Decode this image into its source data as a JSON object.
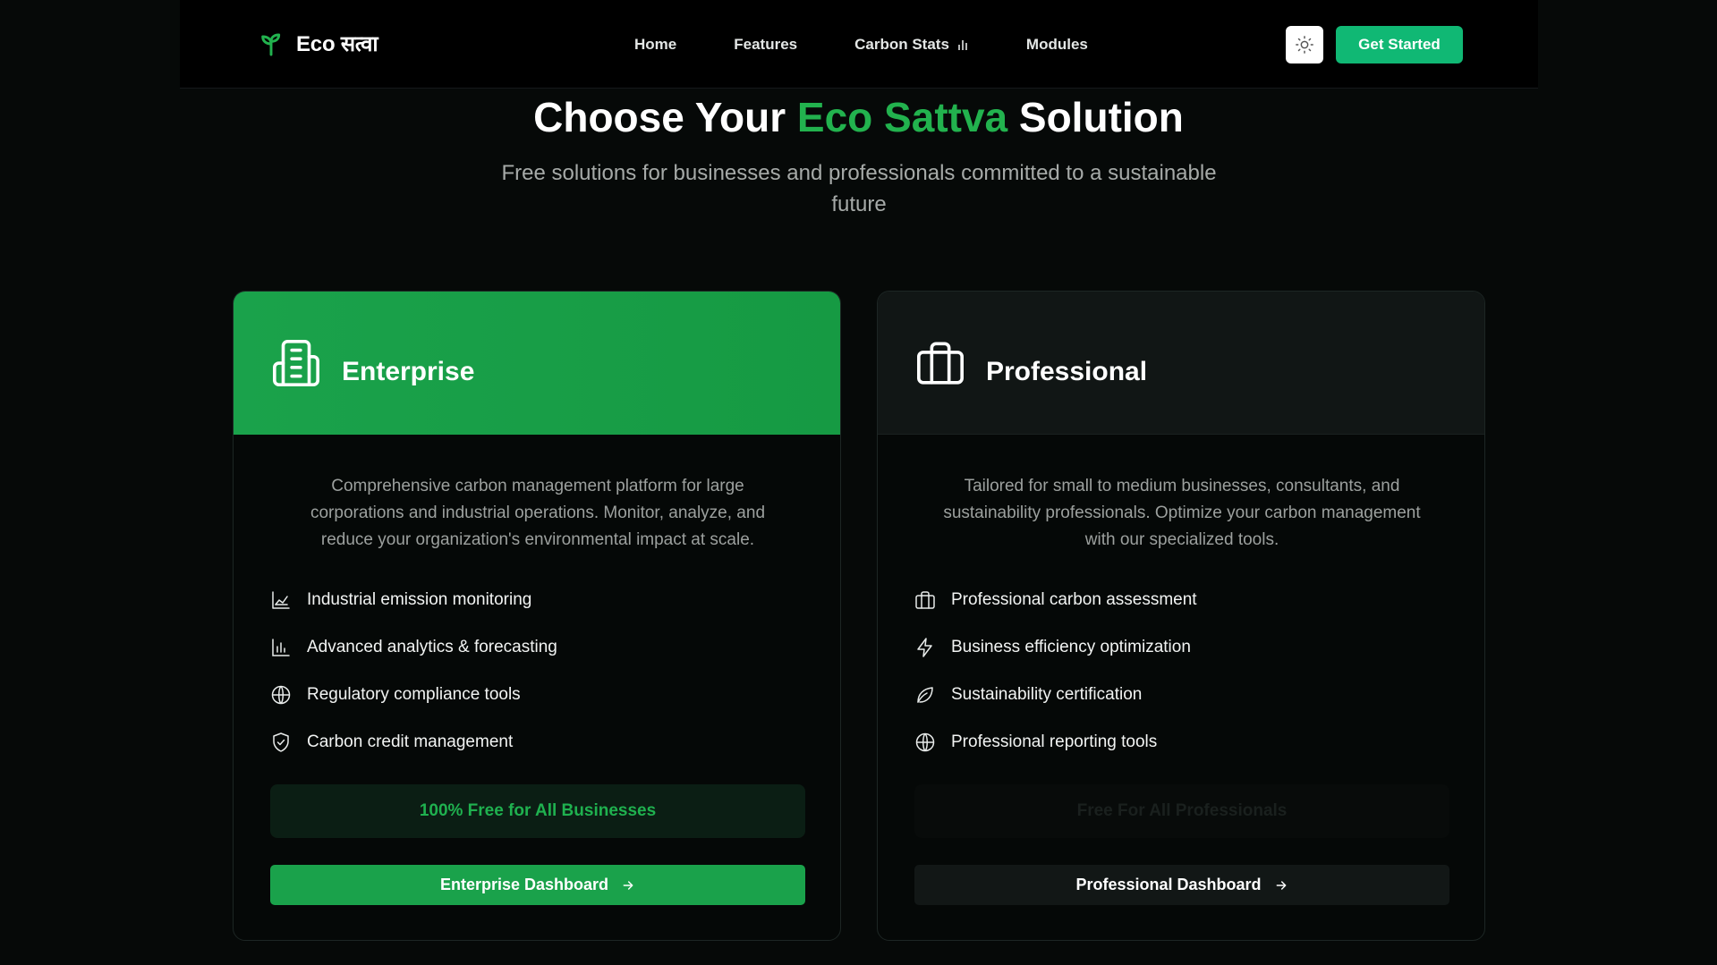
{
  "nav": {
    "logo": "Eco सत्वा",
    "links": [
      {
        "label": "Home",
        "icon": null
      },
      {
        "label": "Features",
        "icon": null
      },
      {
        "label": "Carbon Stats",
        "icon": "bar-chart-icon"
      },
      {
        "label": "Modules",
        "icon": null
      }
    ],
    "theme_icon": "sun-icon",
    "cta": "Get Started"
  },
  "hero": {
    "title_prefix": "Choose Your ",
    "title_accent": "Eco Sattva",
    "title_suffix": " Solution",
    "subtitle": "Free solutions for businesses and professionals committed to a sustainable future"
  },
  "cards": [
    {
      "title": "Enterprise",
      "icon": "building-icon",
      "description": "Comprehensive carbon management platform for large corporations and industrial operations. Monitor, analyze, and reduce your organization's environmental impact at scale.",
      "features": [
        {
          "label": "Industrial emission monitoring",
          "icon": "factory-icon"
        },
        {
          "label": "Advanced analytics & forecasting",
          "icon": "bar-chart-icon"
        },
        {
          "label": "Regulatory compliance tools",
          "icon": "globe-icon"
        },
        {
          "label": "Carbon credit management",
          "icon": "shield-check-icon"
        }
      ],
      "free_label": "100% Free for All Businesses",
      "button": "Enterprise Dashboard"
    },
    {
      "title": "Professional",
      "icon": "briefcase-icon",
      "description": "Tailored for small to medium businesses, consultants, and sustainability professionals. Optimize your carbon management with our specialized tools.",
      "features": [
        {
          "label": "Professional carbon assessment",
          "icon": "briefcase-icon"
        },
        {
          "label": "Business efficiency optimization",
          "icon": "lightning-icon"
        },
        {
          "label": "Sustainability certification",
          "icon": "leaf-icon"
        },
        {
          "label": "Professional reporting tools",
          "icon": "globe-icon"
        }
      ],
      "free_label": "Free For All Professionals",
      "button": "Professional Dashboard"
    }
  ],
  "colors": {
    "accent": "#22b24e",
    "cta": "#10b874",
    "background": "#060908"
  }
}
